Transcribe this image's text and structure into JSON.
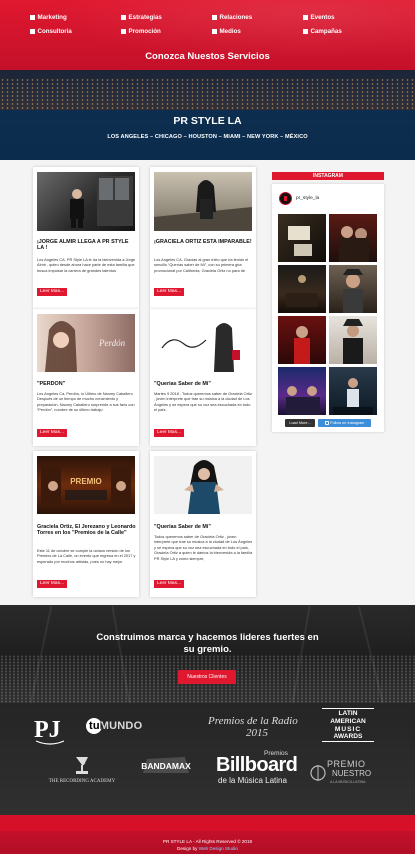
{
  "services": {
    "items": [
      {
        "label": "Marketing"
      },
      {
        "label": "Estrategias"
      },
      {
        "label": "Relaciones"
      },
      {
        "label": "Eventos"
      },
      {
        "label": "Consultoria"
      },
      {
        "label": "Promoción"
      },
      {
        "label": "Medios"
      },
      {
        "label": "Campañas"
      }
    ],
    "title": "Conozca Nuestos Servicios"
  },
  "banner": {
    "title": "PR STYLE LA",
    "cities": "LOS ANGELES – CHICAGO – HOUSTON – MIAMI – NEW YORK – MÉXICO"
  },
  "posts": [
    {
      "title": "¡JORGE ALMIR LLEGA A PR STYLE LA !",
      "excerpt": "Los Angeles CA. PR Style LA le da la bienvenida a Jorge Almir , quien desde ahora hace parte de esta familia que busca impulsar la carrera de grandes talentos",
      "read_more": "Leer Mas..."
    },
    {
      "title": "¡GRACIELA ORTIZ ESTA IMPARABLE!",
      "excerpt": "Los Angeles CA. Gracias al gran éxito que ha tenido el sencillo “Querías saber de Mí”, con su primera gira promocional por California, Graciela Ortiz no para de",
      "read_more": "Leer Mas..."
    },
    {
      "title": "\"PERDON\"",
      "excerpt": "Los Angeles Ca, Perdón, lo Último de Naomy Caballero Después de un tiempo de mucho crecimiento y preparación, Naomy Caballero sorprende a sus fans con “Perdón”, nombre de su último trabajo",
      "read_more": "Leer Mas..."
    },
    {
      "title": "\"Querias Saber de Mi\"",
      "excerpt": "Martes 9 2018 , Todos queremos saber de Graciela Ortiz , joven interprete que trae su música a la ciudad de Los Ángeles y se espera que su voz sea escuchada en todo el país.",
      "read_more": "Leer Mas..."
    },
    {
      "title": "Graciela Ortiz, El Jerezano y Leonardo Torres en los \"Premios de la Calle\"",
      "excerpt": "Este 11 de octubre se cumple la octava versión de los Premios de La Calle, un evento que regresa en el 2017 y esperado por muchos artistas, pues no hay mejor",
      "read_more": "Leer Mas..."
    },
    {
      "title": "\"Querias Saber de Mi\"",
      "excerpt": "Todos queremos saber de Graciela Ortiz , joven interprete que trae su música a la ciudad de Los Ángeles y se espera que su voz sea escuchada en todo el país, Graciela Ortiz a quien le damos la bienvenida a la familia PR Style LA y como siempre,",
      "read_more": "Leer Mas..."
    }
  ],
  "instagram": {
    "heading": "INSTAGRAM",
    "username": "pr_style_la",
    "load_more": "Load More...",
    "follow": "Follow on Instagram"
  },
  "promo": {
    "title": "Construimos marca y hacemos lideres fuertes en su gremio.",
    "button": "Nuestros Clientes"
  },
  "clients": {
    "tumundo": "tuMUNDO",
    "premios_radio": "Premios de la Radio",
    "premios_radio_year": "2015",
    "latin_ama": [
      "LATIN",
      "AMERICAN",
      "MUSIC",
      "AWARDS"
    ],
    "recording_academy": "THE RECORDING ACADEMY",
    "bandamax": "BANDAMAX",
    "billboard_top": "Premios",
    "billboard": "Billboard",
    "billboard_sub": "de la Música Latina",
    "premio_nuestro_1": "PREMIO",
    "premio_nuestro_2": "NUESTRO",
    "premio_nuestro_3": "A LA MÚSICA LATINA"
  },
  "footer": {
    "copyright": "PR STYLE LA - All Rights Reserved © 2019",
    "design_prefix": "Design by",
    "design_by": "Web Design Studio"
  },
  "colors": {
    "accent": "#e0182f",
    "banner_overlay": "#0a2e52",
    "footer": "#d7102a"
  }
}
